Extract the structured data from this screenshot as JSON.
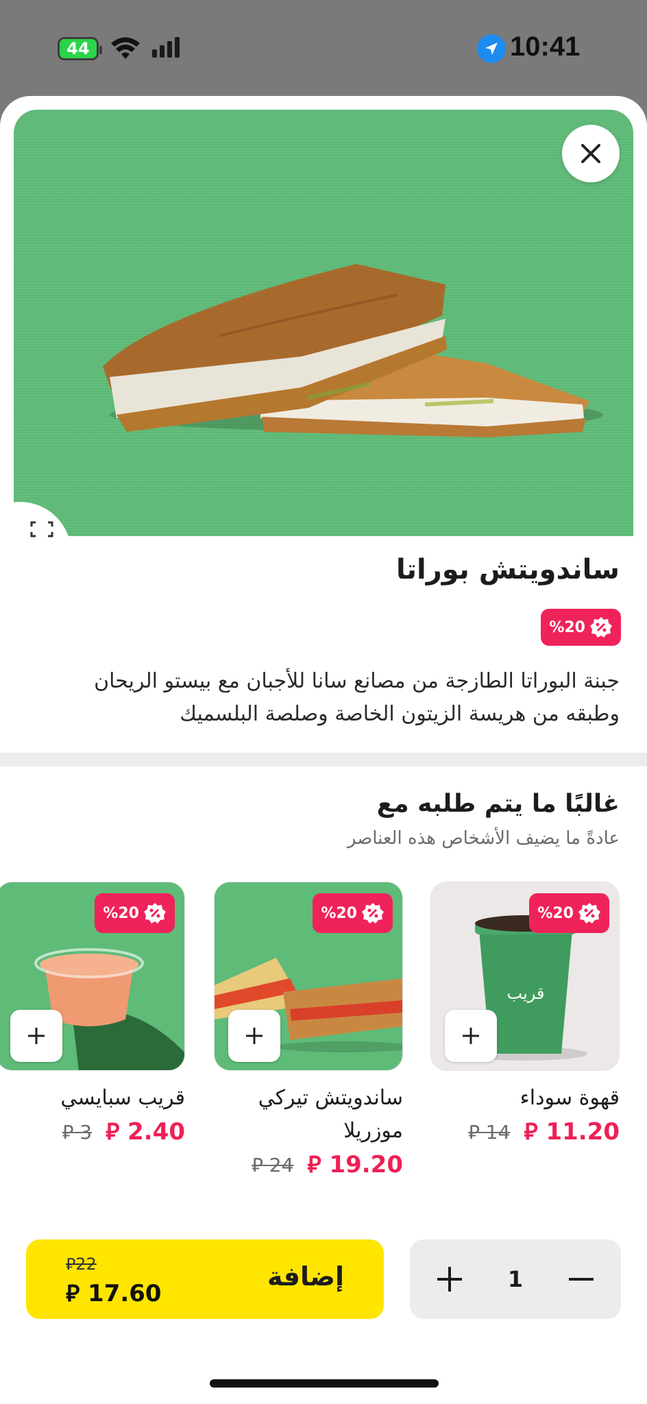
{
  "status_bar": {
    "battery": "44",
    "time": "10:41"
  },
  "product": {
    "title": "ساندويتش بوراتا",
    "discount": "%20",
    "description": "جبنة البوراتا الطازجة من مصانع سانا للأجبان مع بيستو الريحان وطبقه من هريسة الزيتون الخاصة وصلصة البلسميك"
  },
  "recommendations": {
    "title": "غالبًا ما يتم طلبه مع",
    "subtitle": "عادةً ما يضيف الأشخاص هذه العناصر",
    "items": [
      {
        "name": "قهوة سوداء",
        "price": "11.20 ⃁",
        "old_price": "14 ⃁",
        "discount": "%20"
      },
      {
        "name": "ساندويتش تيركي موزريلا",
        "price": "19.20 ⃁",
        "old_price": "24 ⃁",
        "discount": "%20"
      },
      {
        "name": "قريب سبايسي",
        "price": "2.40 ⃁",
        "old_price": "3 ⃁",
        "discount": "%20"
      }
    ]
  },
  "cart": {
    "add_label": "إضافة",
    "old_total": "22",
    "total": "17.60",
    "quantity": "1"
  },
  "colors": {
    "accent_yellow": "#ffe500",
    "discount_red": "#f0225a",
    "price_red": "#ef2055",
    "hero_green": "#5fbb78"
  }
}
